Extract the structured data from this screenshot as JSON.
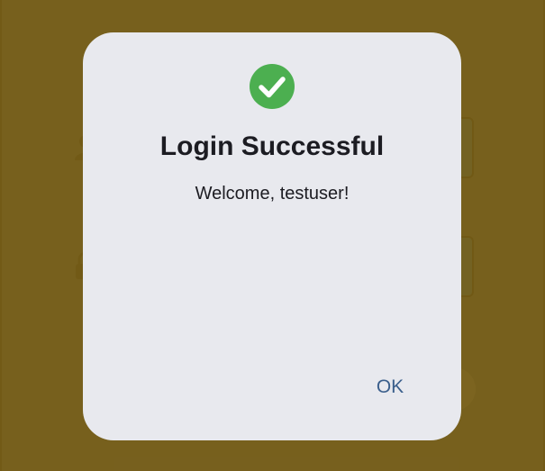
{
  "dialog": {
    "icon": "check-circle-icon",
    "title": "Login Successful",
    "message": "Welcome, testuser!",
    "ok_label": "OK"
  },
  "background_form": {
    "username_icon": "user-icon",
    "password_icon": "lock-icon"
  },
  "colors": {
    "scrim": "#7a5f16",
    "dialog_bg": "#e8e9ee",
    "success_green": "#4caf50",
    "ok_text": "#3b5f8c",
    "field_fill": "#2f7fb8"
  }
}
